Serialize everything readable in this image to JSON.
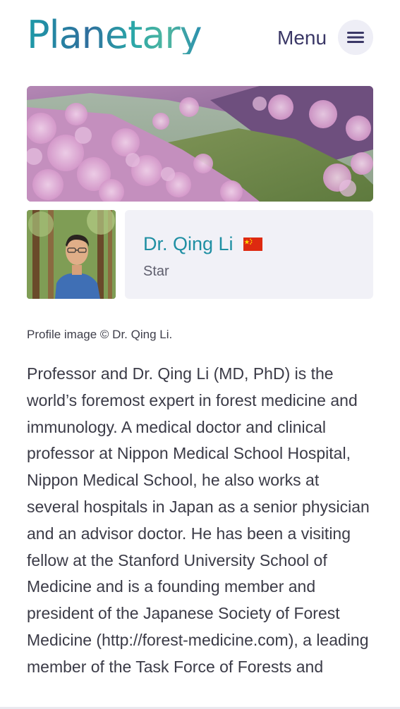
{
  "header": {
    "logo_text": "Planetary",
    "menu_label": "Menu",
    "menu_icon": "hamburger-icon"
  },
  "banner": {
    "description_icon": "landscape-image"
  },
  "profile": {
    "name": "Dr. Qing Li",
    "flag_icon": "china-flag-icon",
    "role": "Star"
  },
  "caption": "Profile image © Dr. Qing Li.",
  "bio": "Professor and Dr. Qing Li (MD, PhD) is the world’s foremost expert in forest medicine and immunology. A medical doctor and clinical professor at Nippon Medical School Hospital, Nippon Medical School, he also works at several hospitals in Japan as a senior physician and an advisor doctor. He has been a visiting fellow at the Stanford University School of Medicine and is a founding member and president of the Japanese Society of Forest Medicine (http://forest-medicine.com), a leading member of the Task Force of Forests and",
  "colors": {
    "brand_teal": "#1f8fa3",
    "menu_text": "#3a3766",
    "card_bg": "#f1f1f7",
    "flag_red": "#de2910",
    "flag_star": "#ffde00"
  }
}
